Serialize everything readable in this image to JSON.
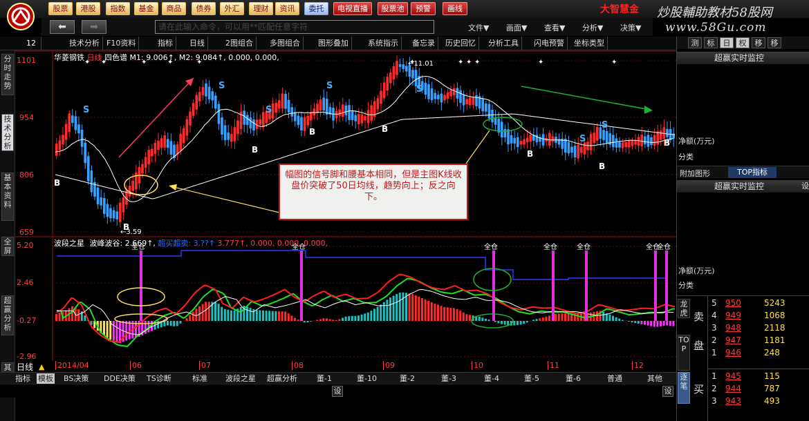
{
  "menu": {
    "items": [
      {
        "label": "股票",
        "style": "gold"
      },
      {
        "label": "港股",
        "style": "gold"
      },
      {
        "label": "指数",
        "style": "gold"
      },
      {
        "label": "基金",
        "style": "gold"
      },
      {
        "label": "商品",
        "style": "gold"
      },
      {
        "label": "债券",
        "style": "gold"
      },
      {
        "label": "外汇",
        "style": "gold"
      },
      {
        "label": "理财",
        "style": "gold"
      },
      {
        "label": "资讯",
        "style": "gold"
      },
      {
        "label": "委托",
        "style": "blue"
      },
      {
        "label": "电视直播",
        "style": "red"
      },
      {
        "label": "股票池",
        "style": "red"
      },
      {
        "label": "预警",
        "style": "red"
      },
      {
        "label": "画线",
        "style": "red"
      }
    ],
    "brand": "大智慧金",
    "watermark_title": "炒股輔助教材58股网",
    "watermark_url": "www.58Gu.com"
  },
  "command": {
    "placeholder": "请在此输入命令，可以用**匹配任意字符"
  },
  "top_right_menu": [
    "文件▼",
    "画面▼",
    "查看▼",
    "分析▼",
    "决策▼"
  ],
  "toolbar": {
    "code": "12",
    "items": [
      "技术分析",
      "F10资料",
      "指标",
      "日线",
      "2图组合",
      "多图组合",
      "图形叠加",
      "系统指示",
      "备忘录",
      "历史回忆",
      "分析工具",
      "闪电预警",
      "坐标类型"
    ]
  },
  "left_tabs": [
    "分时走势",
    "技术分析",
    "基本资料",
    "全屏",
    "超赢分析",
    "其他"
  ],
  "main_legend": {
    "stock": "华菱钢铁",
    "period": "日线",
    "indicator": "四色谱",
    "text": "M1: 9.006↑, M2: 9.084↑, 0.000, 0.000,"
  },
  "sub_legend": {
    "name": "波段之星",
    "text1": "波峰波谷: 2.669↑,",
    "text2": "超买超卖: 3.??↑",
    "text3": "3.777↑, 0.000, 0.000, 0.000,"
  },
  "y_main": [
    "1101",
    "954",
    "806",
    "659"
  ],
  "y_sub": [
    "5.20",
    "2.46",
    "-0.27",
    "-2.96"
  ],
  "annotations": {
    "high_label": "11.01",
    "low_label": "3.59",
    "callout": "幅图的信号脚和腰基本相同，但是主图K线收盘价突破了50日均线，趋势向上；反之向下。",
    "signal": "全仓"
  },
  "x_labels": [
    "2014/04",
    "06",
    "07",
    "08",
    "09",
    "10",
    "11",
    "12"
  ],
  "period_label": "日线",
  "bottom_tabs": [
    "指标",
    "模板",
    "BS决策",
    "DDE决策",
    "TS诊断",
    "标准",
    "波段之星",
    "超赢分析",
    "董-1",
    "董-10",
    "董-2",
    "董-3",
    "董-4",
    "董-5",
    "董-6",
    "普通",
    "其他"
  ],
  "statusbar": {
    "setting": "设"
  },
  "right_panel": {
    "top_tabs": [
      "测",
      "标",
      "日",
      "权",
      "移",
      "移"
    ],
    "monitor_title": "超赢实时监控",
    "net_label": "净额(万元)",
    "fen_lei": "分类",
    "tab_fujia": "附加图形",
    "tab_top": "TOP指标",
    "set": "设",
    "longhu": "龙虎",
    "top": "TOP",
    "sell_label": "卖",
    "pan_label": "盘",
    "buy_label": "买",
    "zhuanpan": "逐笔",
    "sells": [
      {
        "lvl": "5",
        "price": "950",
        "vol": "5243"
      },
      {
        "lvl": "4",
        "price": "949",
        "vol": "1068"
      },
      {
        "lvl": "3",
        "price": "948",
        "vol": "2118"
      },
      {
        "lvl": "2",
        "price": "947",
        "vol": "1181"
      },
      {
        "lvl": "1",
        "price": "946",
        "vol": "248"
      }
    ],
    "buys": [
      {
        "lvl": "1",
        "price": "945",
        "vol": "115"
      },
      {
        "lvl": "2",
        "price": "944",
        "vol": "787"
      },
      {
        "lvl": "3",
        "price": "943",
        "vol": "493"
      }
    ]
  }
}
